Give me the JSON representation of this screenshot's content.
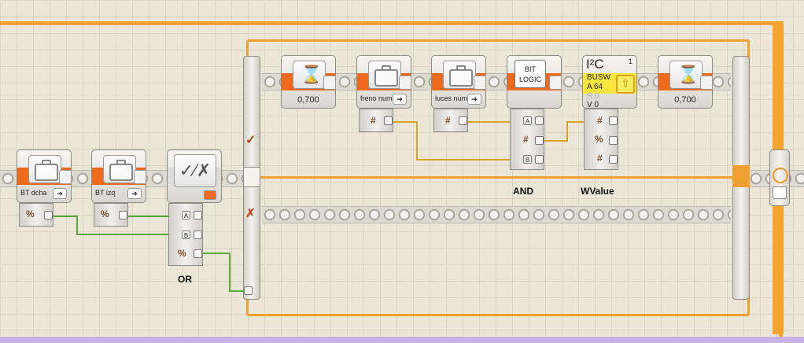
{
  "blocks": {
    "bt_dcha": {
      "label": "BT dcha"
    },
    "bt_izq": {
      "label": "BT izq"
    },
    "wait1": {
      "value": "0,700"
    },
    "freno": {
      "label": "freno num"
    },
    "luces": {
      "label": "luces num"
    },
    "bitlogic": {
      "line1": "BIT",
      "line2": "LOGIC"
    },
    "i2c": {
      "title": "I²C",
      "index": "1",
      "line1": "BUSW",
      "line2": "A 64",
      "line3": "R 0",
      "line4": "V 0"
    },
    "wait2": {
      "value": "0,700"
    }
  },
  "ports": {
    "a": "A",
    "b": "B",
    "hash": "#",
    "percent": "%"
  },
  "labels": {
    "or": "OR",
    "and": "AND",
    "wvalue": "WValue"
  },
  "switch": {
    "check": "✓",
    "cross": "✗"
  },
  "colors": {
    "orange": "#f0a030",
    "green_wire": "#58a83a",
    "yellow_wire": "#d7a520",
    "block_band": "#ee6b1e"
  }
}
